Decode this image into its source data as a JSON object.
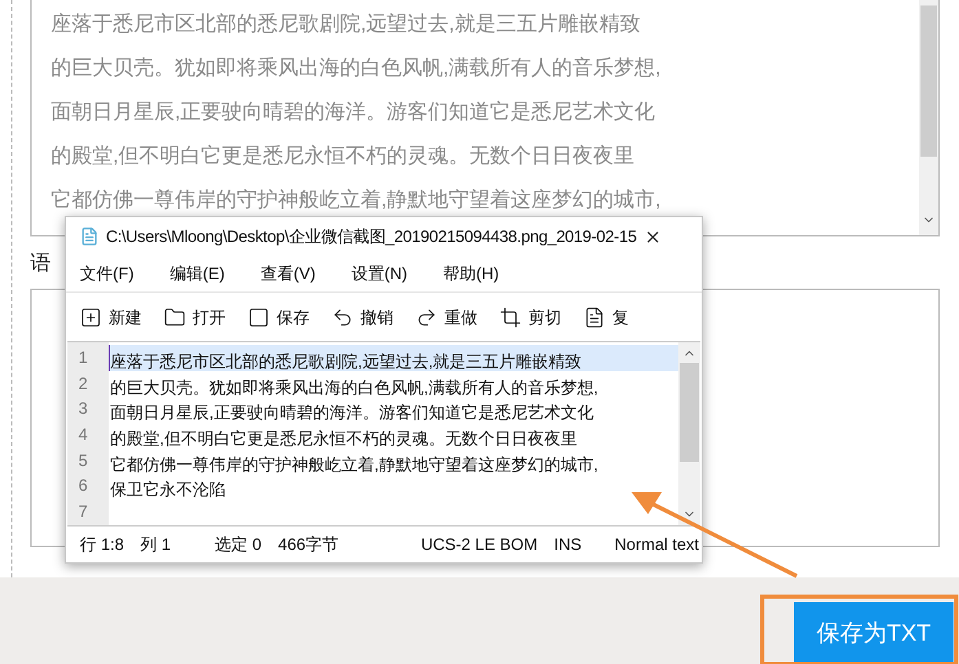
{
  "background": {
    "text_lines": [
      "座落于悉尼市区北部的悉尼歌剧院,远望过去,就是三五片雕嵌精致",
      "的巨大贝壳。犹如即将乘风出海的白色风帆,满载所有人的音乐梦想,",
      "面朝日月星辰,正要驶向晴碧的海洋。游客们知道它是悉尼艺术文化",
      "的殿堂,但不明白它更是悉尼永恒不朽的灵魂。无数个日日夜夜里",
      "它都仿佛一尊伟岸的守护神般屹立着,静默地守望着这座梦幻的城市,"
    ],
    "label": "语"
  },
  "save_button": {
    "label": "保存为TXT"
  },
  "editor_window": {
    "title": "C:\\Users\\Mloong\\Desktop\\企业微信截图_20190215094438.png_2019-02-15",
    "menu": [
      "文件(F)",
      "编辑(E)",
      "查看(V)",
      "设置(N)",
      "帮助(H)"
    ],
    "toolbar": [
      {
        "kind": "new",
        "label": "新建"
      },
      {
        "kind": "open",
        "label": "打开"
      },
      {
        "kind": "save",
        "label": "保存"
      },
      {
        "kind": "undo",
        "label": "撤销"
      },
      {
        "kind": "redo",
        "label": "重做"
      },
      {
        "kind": "cut",
        "label": "剪切"
      },
      {
        "kind": "copy",
        "label": "复"
      }
    ],
    "lines": [
      {
        "number": "1",
        "text": "座落于悉尼市区北部的悉尼歌剧院,远望过去,就是三五片雕嵌精致",
        "current": true
      },
      {
        "number": "2",
        "text": "的巨大贝壳。犹如即将乘风出海的白色风帆,满载所有人的音乐梦想,",
        "current": false
      },
      {
        "number": "3",
        "text": "面朝日月星辰,正要驶向晴碧的海洋。游客们知道它是悉尼艺术文化",
        "current": false
      },
      {
        "number": "4",
        "text": "的殿堂,但不明白它更是悉尼永恒不朽的灵魂。无数个日日夜夜里",
        "current": false
      },
      {
        "number": "5",
        "text": "它都仿佛一尊伟岸的守护神般屹立着,静默地守望着这座梦幻的城市,",
        "current": false
      },
      {
        "number": "6",
        "text": "保卫它永不沦陷",
        "current": false
      },
      {
        "number": "7",
        "current": false
      }
    ],
    "status": [
      "行 1:8",
      "列 1",
      "选定 0",
      "466字节",
      "UCS-2 LE BOM",
      "INS",
      "Normal text"
    ]
  }
}
